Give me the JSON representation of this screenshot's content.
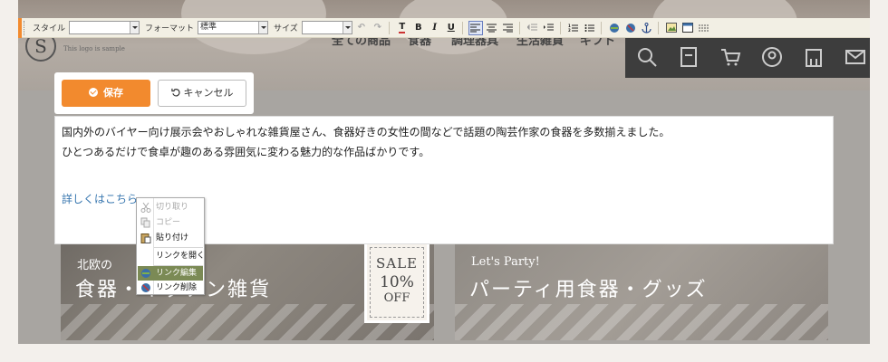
{
  "toolbar": {
    "style_label": "スタイル",
    "style_value": "",
    "format_label": "フォーマット",
    "format_value": "標準",
    "size_label": "サイズ",
    "size_value": "",
    "bold": "B",
    "italic": "I",
    "underline": "U"
  },
  "site": {
    "logo_letter": "S",
    "logo_tagline": "This logo is sample",
    "nav": [
      "全ての商品",
      "食器",
      "調理器具",
      "生活雑貨",
      "ギフト"
    ]
  },
  "edit_bar": {
    "save_label": "保存",
    "cancel_label": "キャンセル"
  },
  "content": {
    "paragraph1": "国内外のバイヤー向け展示会やおしゃれな雑貨屋さん、食器好きの女性の間などで話題の陶芸作家の食器を多数揃えました。",
    "paragraph2": "ひとつあるだけで食卓が趣のある雰囲気に変わる魅力的な作品ばかりです。",
    "link": "詳しくはこちら"
  },
  "banners": {
    "left": {
      "subtitle": "北欧の",
      "title": "食器・キッチン雑貨"
    },
    "sale": {
      "line1": "SALE",
      "line2": "10%",
      "line3": "OFF"
    },
    "right": {
      "subtitle": "Let's Party!",
      "title": "パーティ用食器・グッズ"
    }
  },
  "context_menu": {
    "cut": "切り取り",
    "copy": "コピー",
    "paste": "貼り付け",
    "open_link": "リンクを開く",
    "edit_link": "リンク編集",
    "remove_link": "リンク削除"
  },
  "colors": {
    "accent": "#f28a2e",
    "link": "#3a78b0",
    "menu_highlight": "#7b8a55"
  }
}
